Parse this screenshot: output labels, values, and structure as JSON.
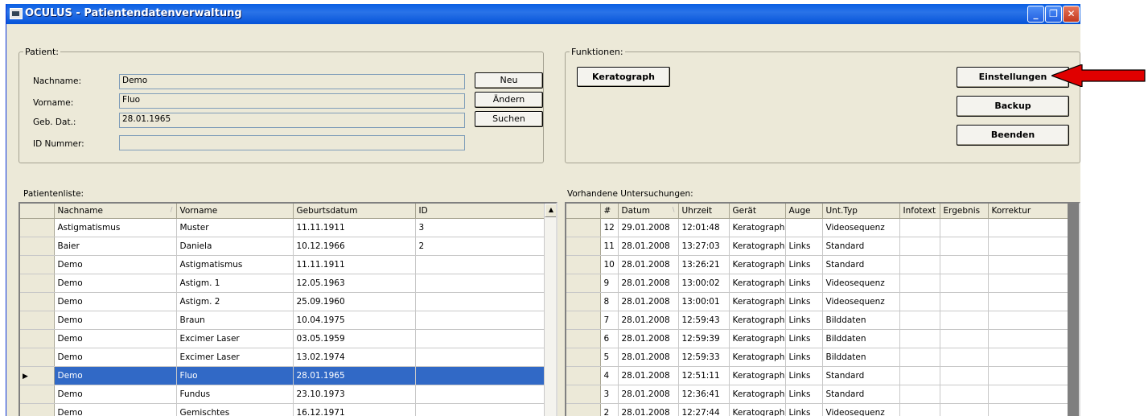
{
  "window": {
    "title": "OCULUS  -  Patientendatenverwaltung",
    "controls": {
      "minimize": "_",
      "maximize": "❐",
      "close": "✕"
    }
  },
  "patient_group": {
    "title": "Patient:",
    "fields": {
      "nachname": {
        "label": "Nachname:",
        "value": "Demo"
      },
      "vorname": {
        "label": "Vorname:",
        "value": "Fluo"
      },
      "geb": {
        "label": "Geb. Dat.:",
        "value": "28.01.1965"
      },
      "id": {
        "label": "ID Nummer:",
        "value": ""
      }
    },
    "buttons": {
      "neu": "Neu",
      "aendern": "Ändern",
      "suchen": "Suchen"
    }
  },
  "functions_group": {
    "title": "Funktionen:",
    "buttons": {
      "keratograph": "Keratograph",
      "einstellungen": "Einstellungen",
      "backup": "Backup",
      "beenden": "Beenden"
    }
  },
  "patient_list": {
    "title": "Patientenliste:",
    "columns": [
      "Nachname",
      "Vorname",
      "Geburtsdatum",
      "ID"
    ],
    "sort_mark": "/",
    "rows": [
      [
        "Astigmatismus",
        "Muster",
        "11.11.1911",
        "3"
      ],
      [
        "Baier",
        "Daniela",
        "10.12.1966",
        "2"
      ],
      [
        "Demo",
        "Astigmatismus",
        "11.11.1911",
        ""
      ],
      [
        "Demo",
        "Astigm. 1",
        "12.05.1963",
        ""
      ],
      [
        "Demo",
        "Astigm. 2",
        "25.09.1960",
        ""
      ],
      [
        "Demo",
        "Braun",
        "10.04.1975",
        ""
      ],
      [
        "Demo",
        "Excimer Laser",
        "03.05.1959",
        ""
      ],
      [
        "Demo",
        "Excimer Laser",
        "13.02.1974",
        ""
      ],
      [
        "Demo",
        "Fluo",
        "28.01.1965",
        ""
      ],
      [
        "Demo",
        "Fundus",
        "23.10.1973",
        ""
      ],
      [
        "Demo",
        "Gemischtes",
        "16.12.1971",
        ""
      ]
    ],
    "selected_index": 8,
    "row_pointer": "▶",
    "scroll_up": "▲"
  },
  "exam_list": {
    "title": "Vorhandene Untersuchungen:",
    "columns": [
      "#",
      "Datum",
      "Uhrzeit",
      "Gerät",
      "Auge",
      "Unt.Typ",
      "Infotext",
      "Ergebnis",
      "Korrektur"
    ],
    "sort_mark": "\\",
    "rows": [
      [
        "12",
        "29.01.2008",
        "12:01:48",
        "Keratograph",
        "",
        "Videosequenz",
        "",
        "",
        ""
      ],
      [
        "11",
        "28.01.2008",
        "13:27:03",
        "Keratograph",
        "Links",
        "Standard",
        "",
        "",
        ""
      ],
      [
        "10",
        "28.01.2008",
        "13:26:21",
        "Keratograph",
        "Links",
        "Standard",
        "",
        "",
        ""
      ],
      [
        "9",
        "28.01.2008",
        "13:00:02",
        "Keratograph",
        "Links",
        "Videosequenz",
        "",
        "",
        ""
      ],
      [
        "8",
        "28.01.2008",
        "13:00:01",
        "Keratograph",
        "Links",
        "Videosequenz",
        "",
        "",
        ""
      ],
      [
        "7",
        "28.01.2008",
        "12:59:43",
        "Keratograph",
        "Links",
        "Bilddaten",
        "",
        "",
        ""
      ],
      [
        "6",
        "28.01.2008",
        "12:59:39",
        "Keratograph",
        "Links",
        "Bilddaten",
        "",
        "",
        ""
      ],
      [
        "5",
        "28.01.2008",
        "12:59:33",
        "Keratograph",
        "Links",
        "Bilddaten",
        "",
        "",
        ""
      ],
      [
        "4",
        "28.01.2008",
        "12:51:11",
        "Keratograph",
        "Links",
        "Standard",
        "",
        "",
        ""
      ],
      [
        "3",
        "28.01.2008",
        "12:36:41",
        "Keratograph",
        "Links",
        "Standard",
        "",
        "",
        ""
      ],
      [
        "2",
        "28.01.2008",
        "12:27:44",
        "Keratograph",
        "Links",
        "Videosequenz",
        "",
        "",
        ""
      ]
    ]
  },
  "colors": {
    "selection": "#3169c6",
    "arrow": "#e00000",
    "titlebar": "#0a5fe3",
    "window_bg": "#ece9d8"
  }
}
